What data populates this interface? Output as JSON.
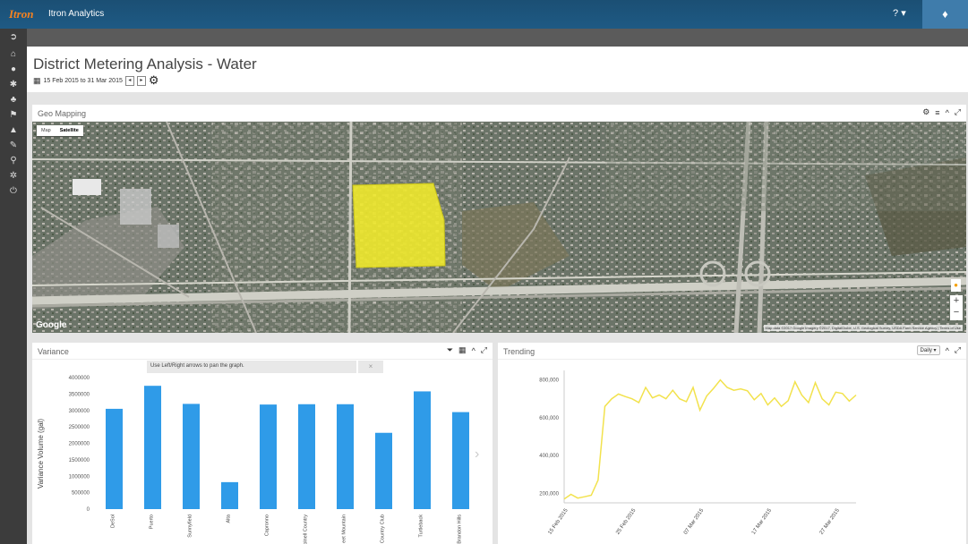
{
  "app": {
    "logo": "Itron",
    "title": "Itron Analytics",
    "help_label": "?",
    "help_caret": "▾",
    "bell_icon": "bell-icon"
  },
  "sidebar": {
    "items": [
      {
        "name": "toggle",
        "icon": "arrow-circle-icon",
        "glyph": "➲"
      },
      {
        "name": "home",
        "icon": "home-icon",
        "glyph": "⌂"
      },
      {
        "name": "user",
        "icon": "user-icon",
        "glyph": "●"
      },
      {
        "name": "tools",
        "icon": "wrench-cross-icon",
        "glyph": "✱"
      },
      {
        "name": "users",
        "icon": "users-icon",
        "glyph": "♣"
      },
      {
        "name": "alerts",
        "icon": "alert-icon",
        "glyph": "⚑"
      },
      {
        "name": "lock",
        "icon": "lock-icon",
        "glyph": "▲"
      },
      {
        "name": "settings",
        "icon": "wrench-icon",
        "glyph": "✎"
      },
      {
        "name": "search",
        "icon": "search-icon",
        "glyph": "⚲"
      },
      {
        "name": "gear",
        "icon": "gear-icon",
        "glyph": "✲"
      },
      {
        "name": "power",
        "icon": "power-icon",
        "glyph": "⏻"
      }
    ]
  },
  "page": {
    "title": "District Metering Analysis - Water",
    "date_range": "15 Feb 2015 to 31 Mar 2015",
    "prev_label": "◂",
    "next_label": "▸",
    "settings_glyph": "⚙"
  },
  "geo": {
    "title": "Geo Mapping",
    "map_type": [
      "Map",
      "Satellite"
    ],
    "selected_map_type": "Satellite",
    "google": "Google",
    "attribution": "Map data ©2017 Google Imagery ©2017, DigitalGlobe, U.S. Geological Survey, USDA Farm Service Agency | Terms of Use",
    "tools": [
      "⚙",
      "≡",
      "^",
      "⤢"
    ],
    "zoom_in": "+",
    "zoom_out": "−"
  },
  "variance": {
    "title": "Variance",
    "banner": "Use Left/Right arrows to pan the graph.",
    "close": "×",
    "tools": [
      "⏷",
      "▦",
      "^",
      "⤢"
    ],
    "next_glyph": "›"
  },
  "trending": {
    "title": "Trending",
    "period": "Daily ▾",
    "tools": [
      "^",
      "⤢"
    ]
  },
  "colors": {
    "topbar": "#1e5a84",
    "bar": "#2f9be8",
    "line": "#f2e24d",
    "highlight": "#f2ec2a"
  },
  "chart_data": [
    {
      "type": "bar",
      "title": "",
      "categories": [
        "DeSol",
        "Puerto",
        "Sunnyfield",
        "Alta",
        "Capronno",
        "Colnell Country",
        "eet Mountain",
        "Country Club",
        "Turtleback",
        "Brandon Hills"
      ],
      "values": [
        3050000,
        3750000,
        3200000,
        820000,
        3180000,
        3190000,
        3190000,
        2320000,
        3580000,
        2950000
      ],
      "ylabel": "Variance Volume (gal)",
      "xlabel": "",
      "yticks": [
        "4000000",
        "3500000",
        "3000000",
        "2500000",
        "2000000",
        "1500000",
        "1000000",
        "500000",
        "0"
      ],
      "ylim": [
        0,
        4000000
      ]
    },
    {
      "type": "line",
      "title": "",
      "x_start": "2015-02-15",
      "x_end": "2015-03-31",
      "xticks": [
        "15 Feb 2015",
        "25 Feb 2015",
        "07 Mar 2015",
        "17 Mar 2015",
        "27 Mar 2015"
      ],
      "yticks": [
        "800,000",
        "600,000",
        "400,000",
        "200,000"
      ],
      "ylim": [
        150000,
        850000
      ],
      "series": [
        {
          "values": [
            170000,
            195000,
            175000,
            182000,
            190000,
            270000,
            660000,
            700000,
            725000,
            712000,
            700000,
            680000,
            760000,
            705000,
            720000,
            700000,
            745000,
            700000,
            685000,
            760000,
            640000,
            715000,
            755000,
            800000,
            760000,
            745000,
            752000,
            742000,
            695000,
            728000,
            668000,
            705000,
            660000,
            690000,
            790000,
            720000,
            680000,
            785000,
            700000,
            668000,
            735000,
            728000,
            688000,
            720000
          ]
        }
      ]
    }
  ]
}
